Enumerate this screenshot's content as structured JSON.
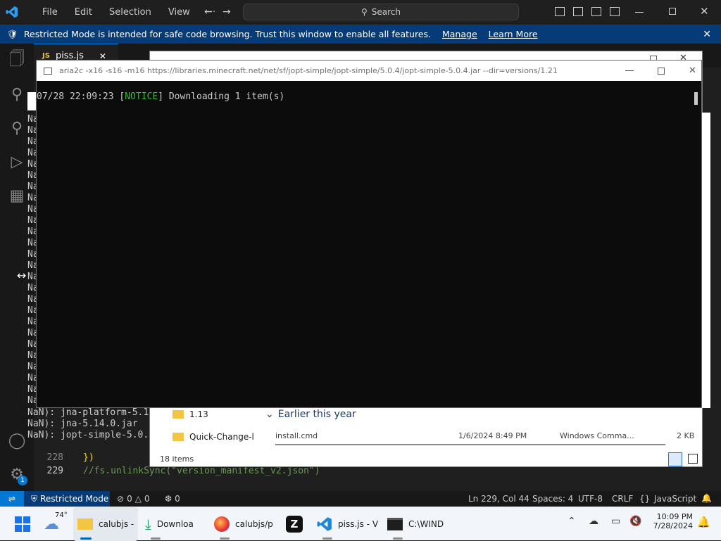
{
  "vscode": {
    "menu": [
      "File",
      "Edit",
      "Selection",
      "View",
      "···"
    ],
    "search_label": "Search",
    "banner": {
      "message": "Restricted Mode is intended for safe code browsing. Trust this window to enable all features.",
      "manage": "Manage",
      "learn_more": "Learn More"
    },
    "tab": {
      "icon": "JS",
      "label": "piss.js"
    },
    "terminal_lines": [
      "Na",
      "Na",
      "Na",
      "Na",
      "Na",
      "Na",
      "Na",
      "Na",
      "Na",
      "Na",
      "Na",
      "Na",
      "Na",
      "Na",
      "Na",
      "Na",
      "Na",
      "Na",
      "Na",
      "Na",
      "Na",
      "Na",
      "Na",
      "Na",
      "Na",
      "Na"
    ],
    "terminal_tail": [
      "NaN): jna-platform-5.1",
      "NaN): jna-5.14.0.jar",
      "NaN): jopt-simple-5.0."
    ],
    "code": [
      {
        "line": "228",
        "text": "})"
      },
      {
        "line": "229",
        "text": "//fs.unlinkSync(\"version_manifest_v2.json\")"
      }
    ],
    "status": {
      "restricted": "Restricted Mode",
      "errors": "0",
      "warnings": "0",
      "ports": "0",
      "position": "Ln 229, Col 44",
      "spaces": "Spaces: 4",
      "encoding": "UTF-8",
      "eol": "CRLF",
      "language": "JavaScript"
    },
    "notification_badge": "1"
  },
  "console": {
    "title": "aria2c  -x16 -s16 -m16 https://libraries.minecraft.net/net/sf/jopt-simple/jopt-simple/5.0.4/jopt-simple-5.0.4.jar --dir=versions/1.21",
    "output_time": "07/28 22:09:23 [",
    "output_notice": "NOTICE",
    "output_msg": "] Downloading 1 item(s)"
  },
  "explorer": {
    "folders": [
      "1.13",
      "Quick-Change-l"
    ],
    "group": "Earlier this year",
    "file": {
      "name": "install.cmd",
      "date": "1/6/2024 8:49 PM",
      "type": "Windows Comma...",
      "size": "2 KB"
    },
    "items_count": "18 items"
  },
  "taskbar": {
    "weather": "74°",
    "apps": [
      "calubjs -",
      "Downloa",
      "calubjs/p",
      "piss.js - V",
      "C:\\WIND"
    ],
    "time": "10:09 PM",
    "date": "7/28/2024"
  }
}
